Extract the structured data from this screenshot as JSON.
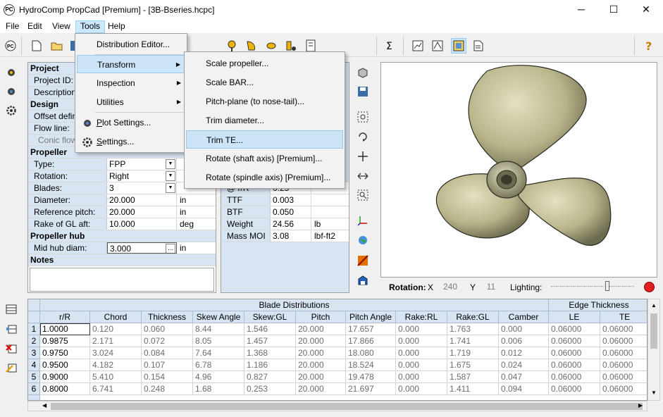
{
  "window": {
    "title": "HydroComp PropCad [Premium] - [3B-Bseries.hcpc]",
    "app_icon": "PC",
    "minimize": "─",
    "maximize": "☐",
    "close": "✕"
  },
  "menubar": [
    "File",
    "Edit",
    "View",
    "Tools",
    "Help"
  ],
  "tools_menu": {
    "items": [
      {
        "label": "Distribution Editor..."
      },
      {
        "label": "Transform",
        "submenu": true
      },
      {
        "label": "Inspection",
        "submenu": true
      },
      {
        "label": "Utilities",
        "submenu": true
      },
      {
        "label": "Plot Settings..."
      },
      {
        "label": "Settings..."
      }
    ]
  },
  "transform_menu": {
    "items": [
      "Scale propeller...",
      "Scale BAR...",
      "Pitch-plane (to nose-tail)...",
      "Trim diameter...",
      "Trim TE...",
      "Rotate (shaft axis) [Premium]...",
      "Rotate (spindle axis) [Premium]..."
    ],
    "highlighted": "Trim TE..."
  },
  "properties": {
    "project": {
      "header": "Project",
      "rows": [
        "Project ID:",
        "Description"
      ]
    },
    "design": {
      "header": "Design",
      "rows": [
        "Offset defin",
        "Flow line:",
        "Conic flow"
      ]
    },
    "propeller": {
      "header": "Propeller",
      "rows": [
        {
          "label": "Type:",
          "value": "FPP",
          "unit": ""
        },
        {
          "label": "Rotation:",
          "value": "Right",
          "unit": ""
        },
        {
          "label": "Blades:",
          "value": "3",
          "unit": ""
        },
        {
          "label": "Diameter:",
          "value": "20.000",
          "unit": "in"
        },
        {
          "label": "Reference pitch:",
          "value": "20.000",
          "unit": "in"
        },
        {
          "label": "Rake of GL aft:",
          "value": "10.000",
          "unit": "deg"
        }
      ]
    },
    "hub": {
      "header": "Propeller hub",
      "row": {
        "label": "Mid hub diam:",
        "value": "3.000",
        "unit": "in",
        "btn": "..."
      }
    },
    "notes": {
      "header": "Notes"
    }
  },
  "summary": {
    "partial_row": {
      "label": "@ r/R",
      "value": "0.25"
    },
    "rows": [
      {
        "label": "TTF",
        "value": "0.003",
        "unit": ""
      },
      {
        "label": "BTF",
        "value": "0.050",
        "unit": ""
      },
      {
        "label": "Weight",
        "value": "24.56",
        "unit": "lb"
      },
      {
        "label": "Mass MOI",
        "value": "3.08",
        "unit": "lbf-ft2"
      }
    ]
  },
  "view": {
    "rotation_label": "Rotation:",
    "x_label": "X",
    "x_value": "240",
    "y_label": "Y",
    "y_value": "11",
    "lighting_label": "Lighting:"
  },
  "table": {
    "group_headers": {
      "blade": "Blade Distributions",
      "edge": "Edge Thickness"
    },
    "columns": [
      "r/R",
      "Chord",
      "Thickness",
      "Skew Angle",
      "Skew:GL",
      "Pitch",
      "Pitch Angle",
      "Rake:RL",
      "Rake:GL",
      "Camber",
      "LE",
      "TE"
    ],
    "rows": [
      [
        "1.0000",
        "0.120",
        "0.060",
        "8.44",
        "1.546",
        "20.000",
        "17.657",
        "0.000",
        "1.763",
        "0.000",
        "0.06000",
        "0.06000"
      ],
      [
        "0.9875",
        "2.171",
        "0.072",
        "8.05",
        "1.457",
        "20.000",
        "17.866",
        "0.000",
        "1.741",
        "0.006",
        "0.06000",
        "0.06000"
      ],
      [
        "0.9750",
        "3.024",
        "0.084",
        "7.64",
        "1.368",
        "20.000",
        "18.080",
        "0.000",
        "1.719",
        "0.012",
        "0.06000",
        "0.06000"
      ],
      [
        "0.9500",
        "4.182",
        "0.107",
        "6.78",
        "1.186",
        "20.000",
        "18.524",
        "0.000",
        "1.675",
        "0.024",
        "0.06000",
        "0.06000"
      ],
      [
        "0.9000",
        "5.410",
        "0.154",
        "4.96",
        "0.827",
        "20.000",
        "19.478",
        "0.000",
        "1.587",
        "0.047",
        "0.06000",
        "0.06000"
      ],
      [
        "0.8000",
        "6.741",
        "0.248",
        "1.68",
        "0.253",
        "20.000",
        "21.697",
        "0.000",
        "1.411",
        "0.094",
        "0.06000",
        "0.06000"
      ]
    ],
    "row_numbers": [
      "1",
      "2",
      "3",
      "4",
      "5",
      "6"
    ]
  },
  "colors": {
    "accent": "#0078d7",
    "section": "#d7e4f2",
    "menu_highlight": "#91c9f7",
    "propeller": "#b8b48a"
  }
}
